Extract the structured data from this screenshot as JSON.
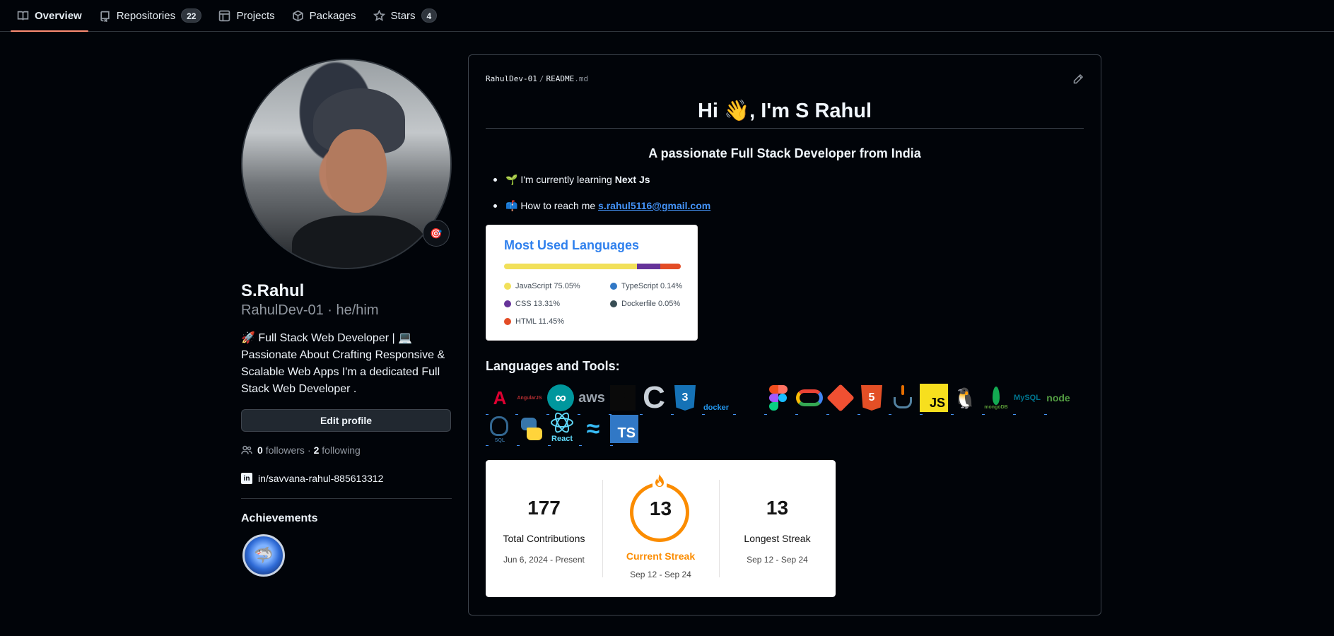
{
  "nav": {
    "tabs": [
      {
        "label": "Overview",
        "icon": "book-icon",
        "active": true
      },
      {
        "label": "Repositories",
        "icon": "repo-icon",
        "count": "22"
      },
      {
        "label": "Projects",
        "icon": "table-icon"
      },
      {
        "label": "Packages",
        "icon": "package-icon"
      },
      {
        "label": "Stars",
        "icon": "star-icon",
        "count": "4"
      }
    ]
  },
  "profile": {
    "name": "S.Rahul",
    "username_line": "RahulDev-01 · he/him",
    "bio": "🚀 Full Stack Web Developer | 💻 Passionate About Crafting Responsive & Scalable Web Apps I'm a dedicated Full Stack Web Developer .",
    "edit_label": "Edit profile",
    "followers_count": "0",
    "followers_label": "followers",
    "following_count": "2",
    "following_label": "following",
    "separator": "·",
    "linkedin": "in/savvana-rahul-885613312",
    "achievements_title": "Achievements",
    "status_emoji": "🎯"
  },
  "readme": {
    "repo": "RahulDev-01",
    "sep": "/",
    "file_name": "README",
    "file_ext": ".md",
    "heading": "Hi 👋, I'm S Rahul",
    "subtitle": "A passionate Full Stack Developer from India",
    "learning_prefix": "🌱 I'm currently learning ",
    "learning_value": "Next Js",
    "reach_prefix": "📫 How to reach me ",
    "email": "s.rahul5116@gmail.com",
    "tools_title": "Languages and Tools:"
  },
  "languages_card": {
    "title": "Most Used Languages",
    "items": [
      {
        "label": "JavaScript 75.05%",
        "color": "#f1e05a",
        "pct": 75.05
      },
      {
        "label": "TypeScript 0.14%",
        "color": "#3178c6",
        "pct": 0.14
      },
      {
        "label": "CSS 13.31%",
        "color": "#663399",
        "pct": 13.31
      },
      {
        "label": "Dockerfile 0.05%",
        "color": "#384d54",
        "pct": 0.05
      },
      {
        "label": "HTML 11.45%",
        "color": "#e34c26",
        "pct": 11.45
      }
    ]
  },
  "tools": [
    {
      "name": "angular",
      "text": "A"
    },
    {
      "name": "angularjs",
      "text": "AngularJS"
    },
    {
      "name": "arduino",
      "text": "∞"
    },
    {
      "name": "aws",
      "text": "aws"
    },
    {
      "name": "bootstrap",
      "text": "B"
    },
    {
      "name": "c",
      "text": "C"
    },
    {
      "name": "css3",
      "text": "3"
    },
    {
      "name": "docker",
      "text": "docker"
    },
    {
      "name": "express",
      "text": ""
    },
    {
      "name": "figma",
      "text": ""
    },
    {
      "name": "gcp",
      "text": ""
    },
    {
      "name": "git",
      "text": ""
    },
    {
      "name": "html5",
      "text": "5"
    },
    {
      "name": "java",
      "text": ""
    },
    {
      "name": "javascript",
      "text": "JS"
    },
    {
      "name": "linux",
      "text": "🐧"
    },
    {
      "name": "mongodb",
      "text": "mongoDB"
    },
    {
      "name": "mysql",
      "text": "MySQL"
    },
    {
      "name": "nodejs",
      "text": "node"
    },
    {
      "name": "postgresql",
      "text": "SQL"
    },
    {
      "name": "python",
      "text": ""
    },
    {
      "name": "react",
      "text": "React"
    },
    {
      "name": "tailwind",
      "text": "≈"
    },
    {
      "name": "typescript",
      "text": "TS"
    }
  ],
  "streak": {
    "total": "177",
    "total_label": "Total Contributions",
    "total_range": "Jun 6, 2024 - Present",
    "current": "13",
    "current_label": "Current Streak",
    "current_range": "Sep 12 - Sep 24",
    "longest": "13",
    "longest_label": "Longest Streak",
    "longest_range": "Sep 12 - Sep 24"
  },
  "colors": {
    "accent_underline": "#fd8c73",
    "link": "#4493f8",
    "streak_orange": "#fb8c00"
  }
}
